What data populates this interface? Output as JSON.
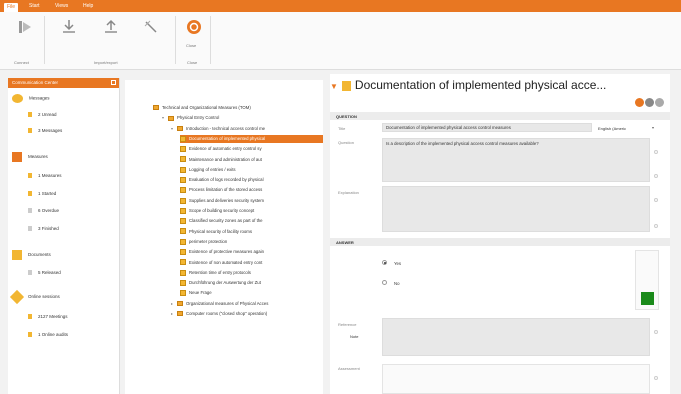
{
  "menu": {
    "tabs": [
      "File",
      "Start",
      "Views",
      "Help"
    ]
  },
  "ribbon": {
    "groups": [
      "Connect",
      "Import/export",
      "Close"
    ],
    "close_label": "Close"
  },
  "left_pane": {
    "title": "Communication Center",
    "sections": [
      {
        "label": "Messages",
        "items": [
          "2 Unread",
          "3 Messages"
        ]
      },
      {
        "label": "Measures",
        "items": [
          "1 Measures",
          "1 Started",
          "6 Overdue",
          "3 Finished"
        ]
      },
      {
        "label": "Documents",
        "items": [
          "5 Released"
        ]
      },
      {
        "label": "Online sessions",
        "items": [
          "2127 Meetings",
          "1 Online audits"
        ]
      }
    ]
  },
  "tree": {
    "items": [
      {
        "label": "Technical and Organizational Measures (TOM)",
        "level": 0,
        "type": "folder",
        "expanded": null
      },
      {
        "label": "Physical Entry Control",
        "level": 1,
        "type": "folder",
        "expanded": true
      },
      {
        "label": "Introduction - technical access control me",
        "level": 2,
        "type": "folder",
        "expanded": true
      },
      {
        "label": "Documentation of implemented physical",
        "level": 3,
        "type": "doc",
        "selected": true
      },
      {
        "label": "Evidence of automatic entry control sy",
        "level": 3,
        "type": "doc"
      },
      {
        "label": "Maintenance and administration of aut",
        "level": 3,
        "type": "doc"
      },
      {
        "label": "Logging of entries / exits",
        "level": 3,
        "type": "doc"
      },
      {
        "label": "Evaluation of logs recorded by physical",
        "level": 3,
        "type": "doc"
      },
      {
        "label": "Process limitation of the stored access",
        "level": 3,
        "type": "doc"
      },
      {
        "label": "Supplies and deliveries security system",
        "level": 3,
        "type": "doc"
      },
      {
        "label": "Scope of building security concept",
        "level": 3,
        "type": "doc"
      },
      {
        "label": "Classified security zones as part of the",
        "level": 3,
        "type": "doc"
      },
      {
        "label": "Physical security of facility rooms",
        "level": 3,
        "type": "doc"
      },
      {
        "label": "perimeter protection",
        "level": 3,
        "type": "doc"
      },
      {
        "label": "Existence of protective measures again",
        "level": 3,
        "type": "doc"
      },
      {
        "label": "Existence of non automated entry cont",
        "level": 3,
        "type": "doc"
      },
      {
        "label": "Retention time of entry protocols",
        "level": 3,
        "type": "doc"
      },
      {
        "label": "Durchführung der Auswertung der Zut",
        "level": 3,
        "type": "doc"
      },
      {
        "label": "Neue Frage",
        "level": 3,
        "type": "doc"
      },
      {
        "label": "Organizational measures of Physical Acces",
        "level": 2,
        "type": "folder",
        "expanded": false
      },
      {
        "label": "Computer rooms (\"closed shop\" operation)",
        "level": 2,
        "type": "folder",
        "expanded": false
      }
    ]
  },
  "detail": {
    "title": "Documentation of implemented physical acce...",
    "question_header": "QUESTION",
    "title_label": "Title",
    "title_value": "Documentation of implemented physical access control measures",
    "language": "English (Americ",
    "question_label": "Question",
    "question_value": "Is a description of the implemented physical access control measures available?",
    "explanation_label": "Explanation",
    "answer_header": "ANSWER",
    "options": [
      "Yes",
      "No"
    ],
    "selected_option": "Yes",
    "reference_label": "Reference",
    "reference_value": "Note",
    "assessment_label": "Assessment"
  },
  "colors": {
    "accent": "#e87722",
    "status_green": "#1a8a1a"
  }
}
